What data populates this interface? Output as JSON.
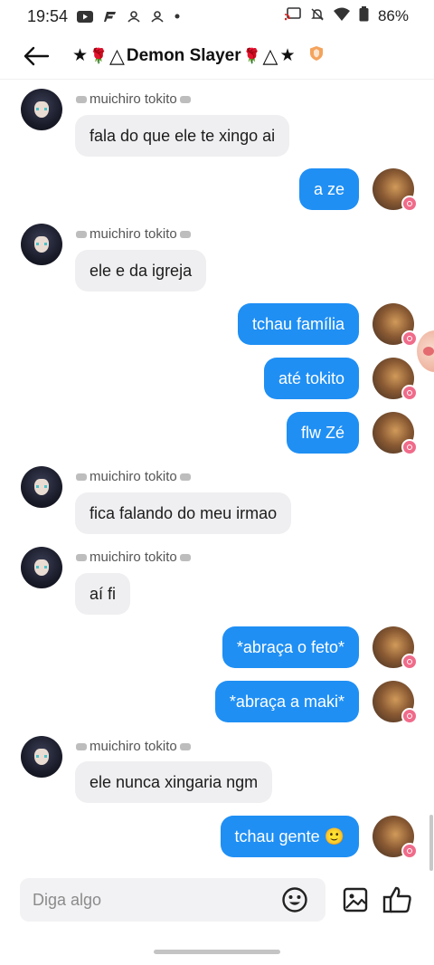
{
  "status_bar": {
    "time": "19:54",
    "battery": "86%",
    "left_icons": [
      "youtube-icon",
      "app-icon",
      "contacts-icon",
      "contacts-icon",
      "dot-icon"
    ],
    "right_icons": [
      "cast-icon",
      "mute-icon",
      "wifi-icon",
      "battery-icon"
    ]
  },
  "header": {
    "star_left": "★",
    "title": "Demon Slayer",
    "star_right": "★",
    "rose": "🌹",
    "triangle": "△"
  },
  "composer": {
    "placeholder": "Diga algo"
  },
  "sender_name": "muichiro tokito",
  "messages": [
    {
      "dir": "in",
      "text": "fala do que ele te xingo ai"
    },
    {
      "dir": "out",
      "text": "a ze"
    },
    {
      "dir": "in",
      "text": "ele e da igreja"
    },
    {
      "dir": "out",
      "text": "tchau família"
    },
    {
      "dir": "out",
      "text": "até tokito"
    },
    {
      "dir": "out",
      "text": "flw Zé"
    },
    {
      "dir": "in",
      "text": "fica falando do meu irmao"
    },
    {
      "dir": "in",
      "text": "aí fi"
    },
    {
      "dir": "out",
      "text": "*abraça o feto*"
    },
    {
      "dir": "out",
      "text": "*abraça a maki*"
    },
    {
      "dir": "in",
      "text": "ele nunca xingaria ngm"
    },
    {
      "dir": "out",
      "text": "tchau gente 🙂"
    }
  ],
  "colors": {
    "outgoing_bubble": "#1f8ff4",
    "incoming_bubble": "#efeff1",
    "badge": "#f06b8a"
  }
}
